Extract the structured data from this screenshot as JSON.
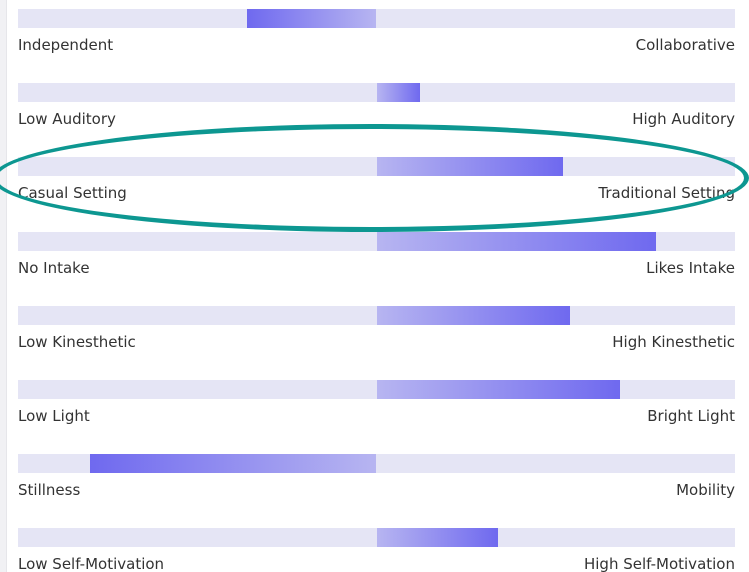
{
  "colors": {
    "track": "#e5e5f5",
    "fill_light": "#b7b5f1",
    "fill_dark": "#6f69ef",
    "highlight": "#0d9791",
    "text": "#333333"
  },
  "scales": [
    {
      "left_label": "Independent",
      "right_label": "Collaborative",
      "value": -0.36
    },
    {
      "left_label": "Low Auditory",
      "right_label": "High Auditory",
      "value": 0.12
    },
    {
      "left_label": "Casual Setting",
      "right_label": "Traditional Setting",
      "value": 0.52,
      "highlighted": true
    },
    {
      "left_label": "No Intake",
      "right_label": "Likes Intake",
      "value": 0.78
    },
    {
      "left_label": "Low Kinesthetic",
      "right_label": "High Kinesthetic",
      "value": 0.54
    },
    {
      "left_label": "Low Light",
      "right_label": "Bright Light",
      "value": 0.68
    },
    {
      "left_label": "Stillness",
      "right_label": "Mobility",
      "value": -0.8
    },
    {
      "left_label": "Low Self-Motivation",
      "right_label": "High Self-Motivation",
      "value": 0.34
    }
  ]
}
